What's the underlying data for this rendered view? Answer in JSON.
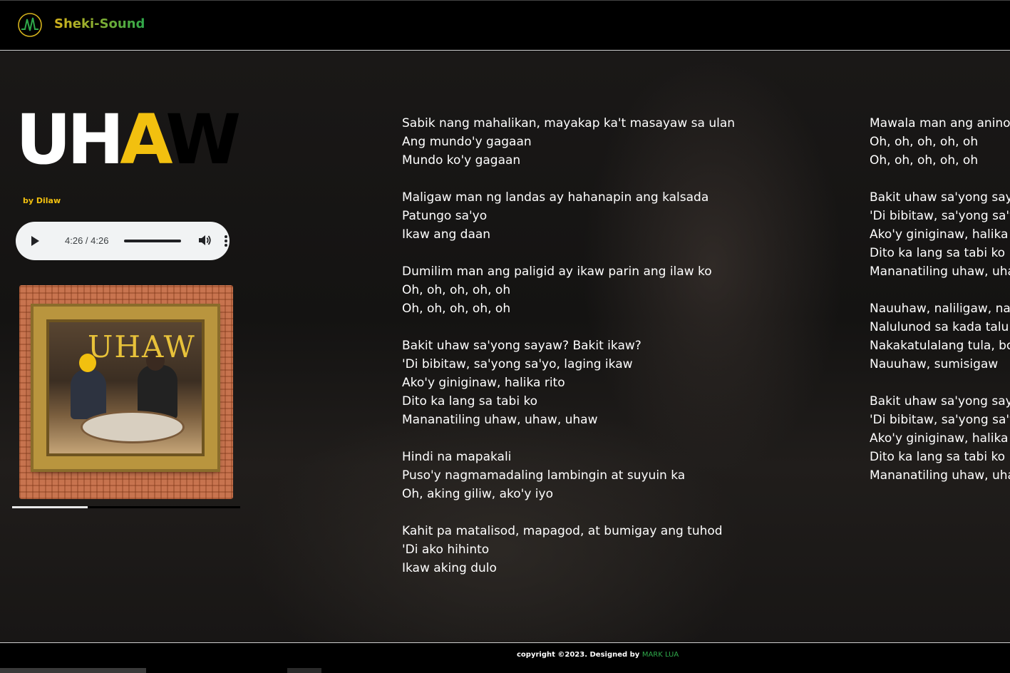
{
  "header": {
    "brand": "Sheki-Sound",
    "logo_icon": "waveform-icon"
  },
  "song": {
    "title_part1": "UH",
    "title_part2": "A",
    "title_part3": "W",
    "artist": "by Dilaw",
    "cover_text": "UHAW"
  },
  "player": {
    "time": "4:26 / 4:26",
    "progress": 1.0
  },
  "track_progress": 0.33,
  "colors": {
    "accent_yellow": "#f2c00f",
    "accent_green": "#2fa84a",
    "background": "#000000"
  },
  "lyrics_col1": [
    [
      "Sabik nang mahalikan, mayakap ka't masayaw sa ulan",
      "Ang mundo'y gagaan",
      "Mundo ko'y gagaan"
    ],
    [
      "Maligaw man ng landas ay hahanapin ang kalsada",
      "Patungo sa'yo",
      "Ikaw ang daan"
    ],
    [
      "Dumilim man ang paligid ay ikaw parin ang ilaw ko",
      "Oh, oh, oh, oh, oh",
      "Oh, oh, oh, oh, oh"
    ],
    [
      "Bakit uhaw sa'yong sayaw? Bakit ikaw?",
      "'Di bibitaw, sa'yong sa'yo, laging ikaw",
      "Ako'y giniginaw, halika rito",
      "Dito ka lang sa tabi ko",
      "Mananatiling uhaw, uhaw, uhaw"
    ],
    [
      "Hindi na mapakali",
      "Puso'y nagmamadaling lambingin at suyuin ka",
      "Oh, aking giliw, ako'y iyo"
    ],
    [
      "Kahit pa matalisod, mapagod, at bumigay ang tuhod",
      "'Di ako hihinto",
      "Ikaw aking dulo"
    ]
  ],
  "lyrics_col2": [
    [
      "Mawala man ang anino",
      "Oh, oh, oh, oh, oh",
      "Oh, oh, oh, oh, oh"
    ],
    [
      "Bakit uhaw sa'yong saya",
      "'Di bibitaw, sa'yong sa'y",
      "Ako'y giniginaw, halika r",
      "Dito ka lang sa tabi ko",
      "Mananatiling uhaw, uha"
    ],
    [
      "Nauuhaw, naliligaw, na",
      "Nalulunod sa kada talu",
      "Nakakatulalang tula, bo",
      "Nauuhaw, sumisigaw"
    ],
    [
      "Bakit uhaw sa'yong saya",
      "'Di bibitaw, sa'yong sa'y",
      "Ako'y giniginaw, halika r",
      "Dito ka lang sa tabi ko",
      "Mananatiling uhaw, uha"
    ]
  ],
  "footer": {
    "copyright": "copyright ©2023. Designed by",
    "designer": "MARK LUA"
  }
}
